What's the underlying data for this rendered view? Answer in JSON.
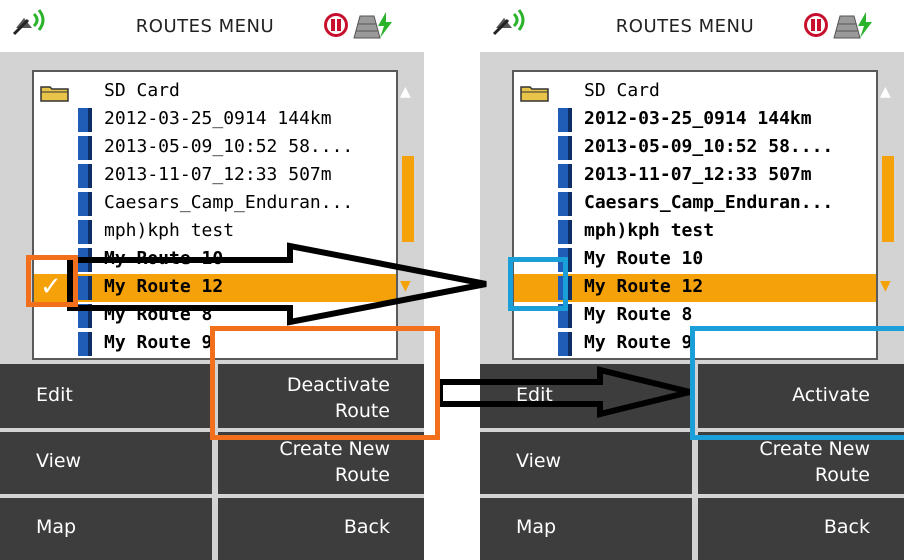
{
  "colors": {
    "accent_orange": "#f5a20a",
    "annotation_orange": "#f26f1c",
    "annotation_blue": "#1a9fd8",
    "button_dark": "#3d3d3d",
    "panel_gray": "#d3d3d3",
    "file_icon_blue": "#1f5db6"
  },
  "left_screen": {
    "header": {
      "title": "ROUTES MENU",
      "icons": [
        "gps-signal-icon",
        "record-pause-icon",
        "battery-charging-icon"
      ]
    },
    "list": {
      "folder": "SD Card",
      "items": [
        "2012-03-25_0914 144km",
        "2013-05-09_10:52 58....",
        "2013-11-07_12:33 507m",
        "Caesars_Camp_Enduran...",
        "mph)kph test",
        "My Route 10",
        "My Route 12",
        "My Route 8",
        "My Route 9"
      ],
      "selected_label": "My Route 12",
      "checked_label": "My Route 12"
    },
    "buttons": {
      "edit": "Edit",
      "action": "Deactivate\nRoute",
      "view": "View",
      "create": "Create New\nRoute",
      "map": "Map",
      "back": "Back"
    }
  },
  "right_screen": {
    "header": {
      "title": "ROUTES MENU",
      "icons": [
        "gps-signal-icon",
        "record-pause-icon",
        "battery-charging-icon"
      ]
    },
    "list": {
      "folder": "SD Card",
      "items": [
        "2012-03-25_0914 144km",
        "2013-05-09_10:52 58....",
        "2013-11-07_12:33 507m",
        "Caesars_Camp_Enduran...",
        "mph)kph test",
        "My Route 10",
        "My Route 12",
        "My Route 8",
        "My Route 9"
      ],
      "selected_label": "My Route 12",
      "checked_label": ""
    },
    "buttons": {
      "edit": "Edit",
      "action": "Activate",
      "view": "View",
      "create": "Create New\nRoute",
      "map": "Map",
      "back": "Back"
    }
  },
  "annotations": [
    "arrow-to-selection",
    "arrow-to-activate-button",
    "orange-highlight-boxes",
    "blue-highlight-boxes"
  ]
}
